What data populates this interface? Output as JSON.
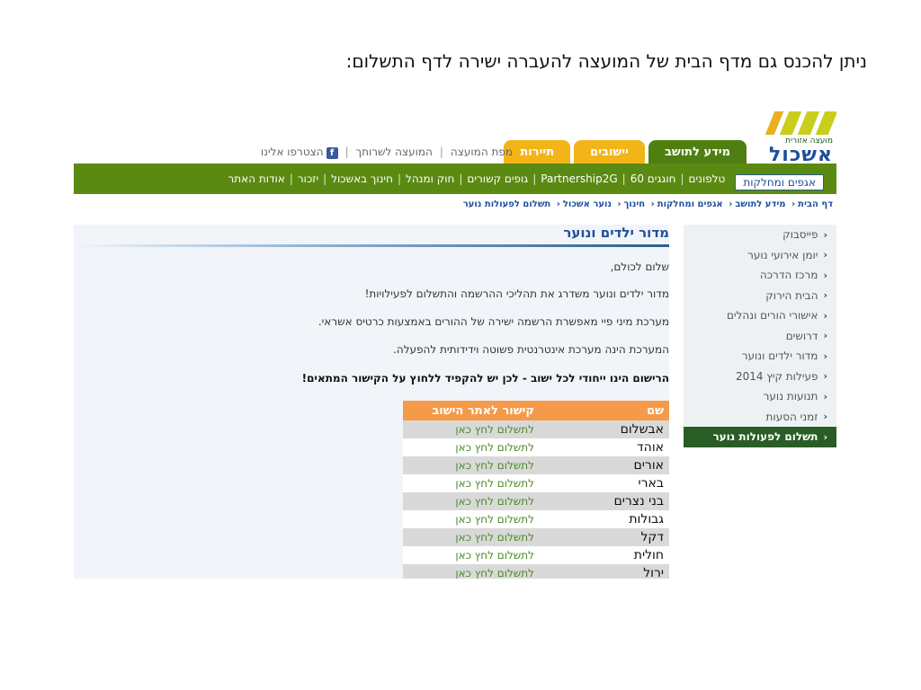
{
  "caption": "ניתן להכנס גם מדף הבית של המועצה להעברה ישירה לדף התשלום:",
  "logo": {
    "subtitle": "מועצה אזורית",
    "name": "אשכול"
  },
  "tabs": [
    {
      "label": "מידע לתושב",
      "active": true
    },
    {
      "label": "יישובים",
      "active": false
    },
    {
      "label": "תיירות",
      "active": false
    }
  ],
  "toplinks": [
    "מפת המועצה",
    "המועצה לשרותך",
    "הצטרפו אלינו"
  ],
  "nav": {
    "current": "אגפים ומחלקות",
    "items": [
      "טלפונים",
      "חוגגים 60",
      "Partnership2G",
      "גופים קשורים",
      "חוק ומנהל",
      "חינוך באשכול",
      "יזכור",
      "אודות האתר"
    ]
  },
  "breadcrumbs": [
    "דף הבית",
    "מידע לתושב",
    "אגפים ומחלקות",
    "חינוך",
    "נוער אשכול",
    "תשלום לפעולות נוער"
  ],
  "sidebar": [
    {
      "label": "פייסבוק",
      "active": false
    },
    {
      "label": "יומן אירועי נוער",
      "active": false
    },
    {
      "label": "מרכז הדרכה",
      "active": false
    },
    {
      "label": "הבית הירוק",
      "active": false
    },
    {
      "label": "אישורי הורים ונהלים",
      "active": false
    },
    {
      "label": "דרושים",
      "active": false
    },
    {
      "label": "מדור ילדים ונוער",
      "active": false
    },
    {
      "label": "פעילות קיץ 2014",
      "active": false
    },
    {
      "label": "תנועות נוער",
      "active": false
    },
    {
      "label": "זמני הסעות",
      "active": false
    },
    {
      "label": "תשלום לפעולות נוער",
      "active": true
    }
  ],
  "content": {
    "title": "מדור ילדים ונוער",
    "greeting": "שלום לכולם,",
    "p1": "מדור ילדים ונוער משדרג את תהליכי ההרשמה והתשלום לפעילויות!",
    "p2": "מערכת מיני פיי מאפשרת הרשמה ישירה של ההורים באמצעות כרטיס אשראי.",
    "p3": "המערכת הינה מערכת אינטרנטית פשוטה וידידותית להפעלה.",
    "p4": "הרישום הינו ייחודי לכל ישוב - לכן יש להקפיד ללחוץ על הקישור המתאים!"
  },
  "table": {
    "headers": {
      "name": "שם",
      "link": "קישור לאתר הישוב"
    },
    "rows": [
      {
        "name": "אבשלום",
        "link": "לתשלום לחץ כאן"
      },
      {
        "name": "אוהד",
        "link": "לתשלום לחץ כאן"
      },
      {
        "name": "אורים",
        "link": "לתשלום לחץ כאן"
      },
      {
        "name": "בארי",
        "link": "לתשלום לחץ כאן"
      },
      {
        "name": "בני נצרים",
        "link": "לתשלום לחץ כאן"
      },
      {
        "name": "גבולות",
        "link": "לתשלום לחץ כאן"
      },
      {
        "name": "דקל",
        "link": "לתשלום לחץ כאן"
      },
      {
        "name": "חולית",
        "link": "לתשלום לחץ כאן"
      },
      {
        "name": "ירול",
        "link": "לתשלום לחץ כאן"
      }
    ]
  },
  "colors": {
    "nav_green": "#5a8a12",
    "tab_yellow": "#f3b417",
    "link_blue": "#1f4f9a",
    "table_header": "#f59a49",
    "active_side": "#2a5c25"
  }
}
